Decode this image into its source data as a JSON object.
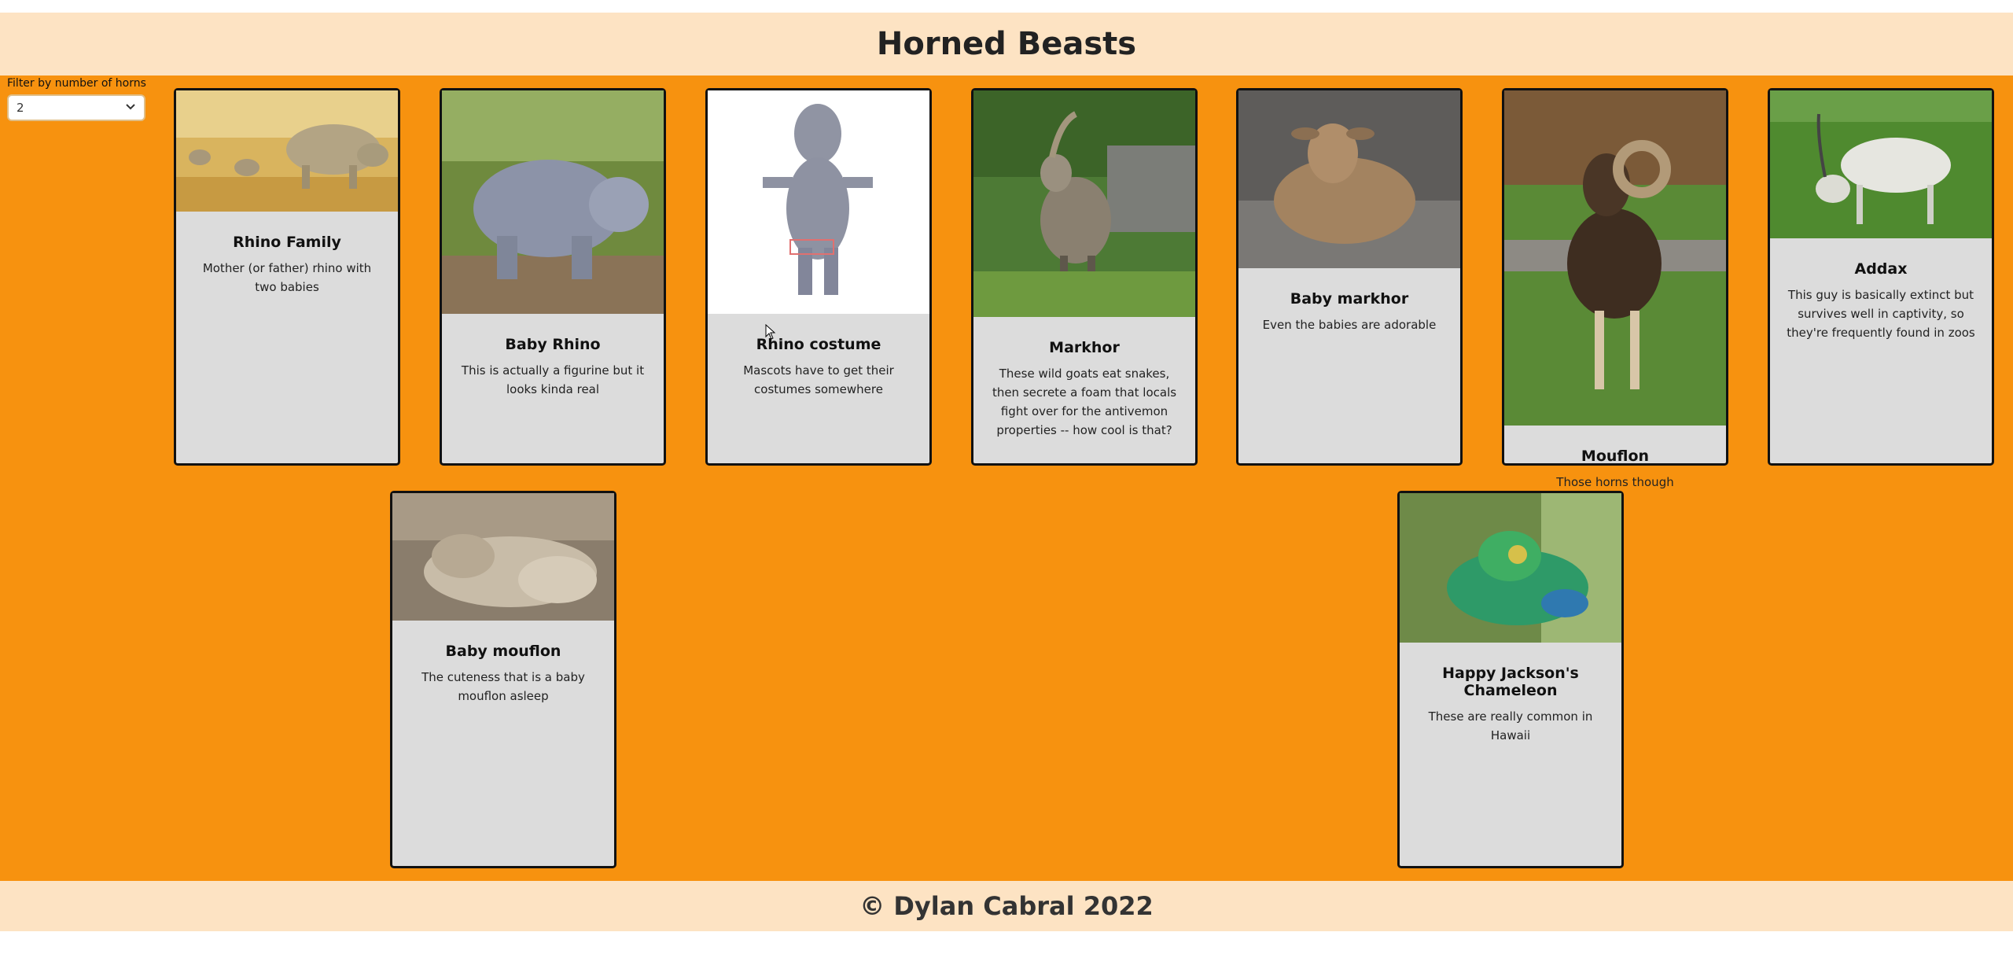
{
  "header": {
    "title": "Horned Beasts"
  },
  "filter": {
    "label": "Filter by number of horns",
    "selected": "2"
  },
  "cards": [
    {
      "title": "Rhino Family",
      "description": "Mother (or father) rhino with two babies"
    },
    {
      "title": "Baby Rhino",
      "description": "This is actually a figurine but it looks kinda real"
    },
    {
      "title": "Rhino costume",
      "description": "Mascots have to get their costumes somewhere"
    },
    {
      "title": "Markhor",
      "description": "These wild goats eat snakes, then secrete a foam that locals fight over for the antivemon properties -- how cool is that?"
    },
    {
      "title": "Baby markhor",
      "description": "Even the babies are adorable"
    },
    {
      "title": "Mouflon",
      "description": "Those horns though"
    },
    {
      "title": "Addax",
      "description": "This guy is basically extinct but survives well in captivity, so they're frequently found in zoos"
    },
    {
      "title": "Baby mouflon",
      "description": "The cuteness that is a baby mouflon asleep"
    },
    {
      "title": "Happy Jackson's Chameleon",
      "description": "These are really common in Hawaii"
    }
  ],
  "footer": {
    "text": "© Dylan Cabral 2022"
  }
}
